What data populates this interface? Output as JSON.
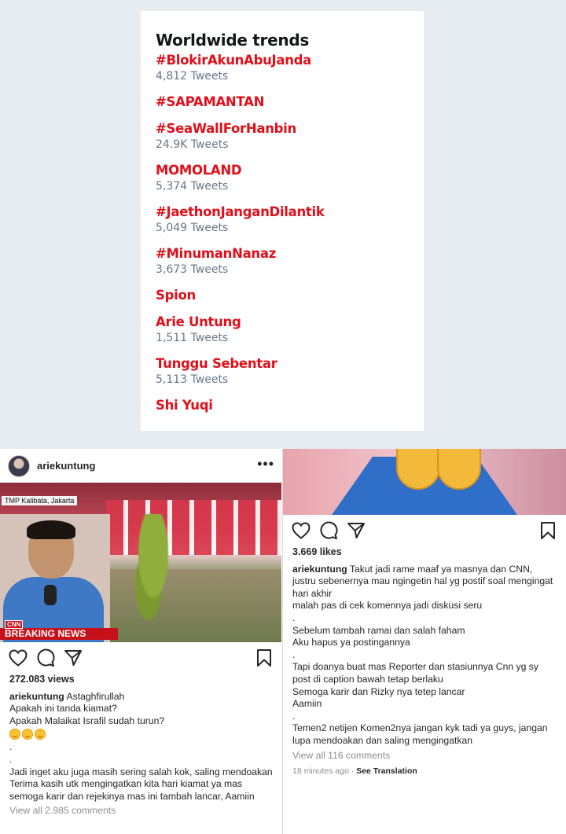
{
  "trends": {
    "title": "Worldwide trends",
    "items": [
      {
        "name": "#BlokirAkunAbuJanda",
        "count": "4,812 Tweets"
      },
      {
        "name": "#SAPAMANTAN",
        "count": ""
      },
      {
        "name": "#SeaWallForHanbin",
        "count": "24.9K Tweets"
      },
      {
        "name": "MOMOLAND",
        "count": "5,374 Tweets"
      },
      {
        "name": "#JaethonJanganDilantik",
        "count": "5,049 Tweets"
      },
      {
        "name": "#MinumanNanaz",
        "count": "3,673 Tweets"
      },
      {
        "name": "Spion",
        "count": ""
      },
      {
        "name": "Arie Untung",
        "count": "1,511 Tweets"
      },
      {
        "name": "Tunggu Sebentar",
        "count": "5,113 Tweets"
      },
      {
        "name": "Shi Yuqi",
        "count": ""
      }
    ],
    "accent_color": "#e0101a"
  },
  "left_post": {
    "username": "ariekuntung",
    "video": {
      "location_tag": "TMP Kalibata, Jakarta",
      "channel": "CNN",
      "banner": "BREAKING NEWS"
    },
    "views": "272.083 views",
    "caption_user": "ariekuntung",
    "caption_lines": [
      "Astaghfirullah",
      "Apakah ini tanda kiamat?",
      "Apakah Malaikat Israfil sudah turun?",
      ".",
      ".",
      "Jadi inget aku juga masih sering salah kok, saling mendoakan",
      "Terima kasih utk mengingatkan kita hari kiamat ya mas semoga karir dan rejekinya mas ini tambah lancar, Aamiin"
    ],
    "view_comments": "View all 2.985 comments",
    "icons": [
      "heart-icon",
      "comment-icon",
      "share-icon",
      "bookmark-icon"
    ]
  },
  "right_post": {
    "likes": "3.669 likes",
    "caption_user": "ariekuntung",
    "caption_lines": [
      "Takut jadi rame maaf ya masnya dan CNN, justru sebenernya mau ngingetin hal yg postif soal mengingat hari akhir",
      "malah pas di cek komennya jadi diskusi seru",
      ".",
      "Sebelum tambah ramai dan salah faham",
      "Aku hapus ya postingannya",
      ".",
      "Tapi doanya buat mas Reporter dan stasiunnya Cnn yg sy post di caption bawah tetap berlaku",
      "Semoga karir dan Rizky nya tetep lancar",
      "Aamiin",
      ".",
      "Temen2 netijen Komen2nya jangan kyk tadi ya guys, jangan lupa mendoakan dan saling mengingatkan"
    ],
    "view_comments": "View all 116 comments",
    "time": "18 minutes ago",
    "translation": "See Translation",
    "icons": [
      "heart-icon",
      "comment-icon",
      "share-icon",
      "bookmark-icon"
    ]
  }
}
